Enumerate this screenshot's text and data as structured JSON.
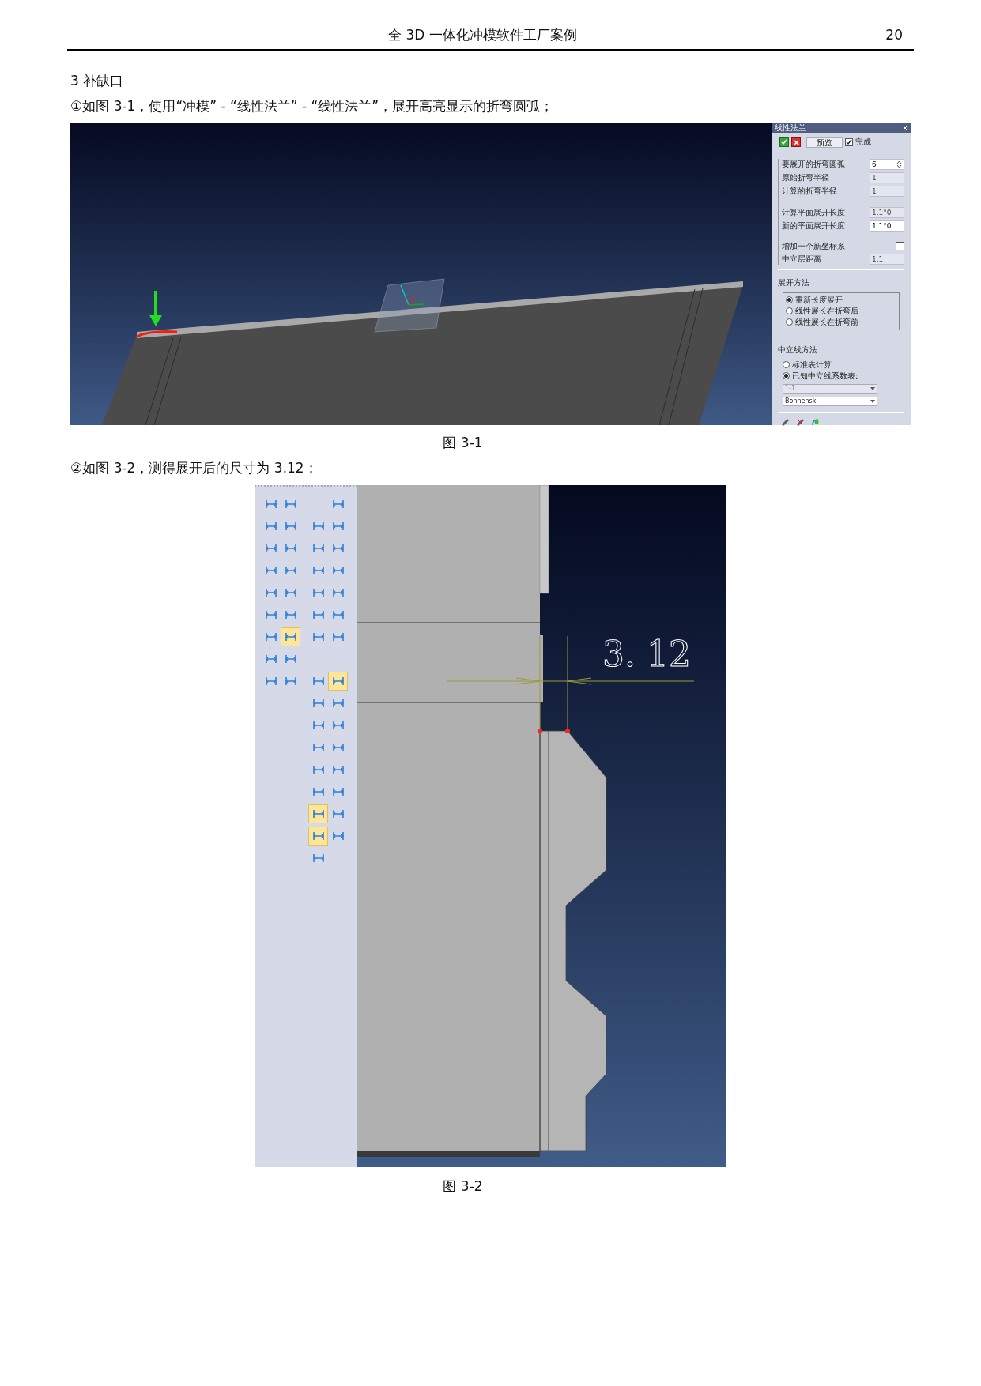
{
  "header": {
    "title": "全 3D 一体化冲模软件工厂案例",
    "page": "20"
  },
  "section_title": "3 补缺口",
  "step_1": "①如图 3-1，使用“冲模” - “线性法兰” - “线性法兰”，展开高亮显示的折弯圆弧；",
  "figure_1": {
    "caption": "图 3-1",
    "dialog": {
      "title": "线性法兰",
      "preview_button": "预览",
      "finish": {
        "label": "完成",
        "checked": true
      },
      "fields": [
        {
          "kind": "spin",
          "label": "要展开的折弯圆弧",
          "value": "6",
          "disabled": false
        },
        {
          "kind": "text",
          "label": "原始折弯半径",
          "value": "1",
          "disabled": true
        },
        {
          "kind": "text",
          "label": "计算的折弯半径",
          "value": "1",
          "disabled": true
        },
        {
          "kind": "text",
          "label": "计算平面展开长度",
          "value": "1.1°0",
          "disabled": true
        },
        {
          "kind": "text",
          "label": "新的平面展开长度",
          "value": "1.1°0",
          "disabled": false
        },
        {
          "kind": "checkbox",
          "label": "增加一个新坐标系",
          "checked": false
        },
        {
          "kind": "text",
          "label": "中立层距离",
          "value": "1.1",
          "disabled": true
        }
      ],
      "unfold_method": {
        "title": "展开方法",
        "options": [
          {
            "label": "重新长度展开",
            "selected": true
          },
          {
            "label": "线性展长在折弯后",
            "selected": false
          },
          {
            "label": "线性展长在折弯前",
            "selected": false
          }
        ]
      },
      "neutral_method": {
        "title": "中立线方法",
        "options": [
          {
            "label": "标准表计算",
            "selected": false
          },
          {
            "label": "已知中立线系数表:",
            "selected": true
          }
        ],
        "selects": [
          {
            "value": "1-1",
            "disabled": true
          },
          {
            "value": "Bonnenski",
            "disabled": false
          }
        ]
      }
    }
  },
  "step_2": "②如图 3-2，测得展开后的尺寸为 3.12；",
  "figure_2": {
    "caption": "图 3-2",
    "dimension": "3. 12",
    "toolbar": [
      [
        {
          "kind": "tool",
          "selected": false
        },
        {
          "kind": "tool",
          "selected": false
        },
        {
          "kind": "blank"
        },
        {
          "kind": "blank"
        },
        {
          "kind": "tool",
          "selected": false
        }
      ],
      [
        {
          "kind": "tool",
          "selected": false
        },
        {
          "kind": "tool",
          "selected": false
        },
        {
          "kind": "blank"
        },
        {
          "kind": "tool",
          "selected": false
        },
        {
          "kind": "tool",
          "selected": false
        }
      ],
      [
        {
          "kind": "tool",
          "selected": false
        },
        {
          "kind": "tool",
          "selected": false
        },
        {
          "kind": "blank"
        },
        {
          "kind": "tool",
          "selected": false
        },
        {
          "kind": "tool",
          "selected": false
        }
      ],
      [
        {
          "kind": "tool",
          "selected": false
        },
        {
          "kind": "tool",
          "selected": false
        },
        {
          "kind": "blank"
        },
        {
          "kind": "tool",
          "selected": false
        },
        {
          "kind": "tool",
          "selected": false
        }
      ],
      [
        {
          "kind": "tool",
          "selected": false
        },
        {
          "kind": "tool",
          "selected": false
        },
        {
          "kind": "blank"
        },
        {
          "kind": "tool",
          "selected": false
        },
        {
          "kind": "tool",
          "selected": false
        }
      ],
      [
        {
          "kind": "tool",
          "selected": false
        },
        {
          "kind": "tool",
          "selected": false
        },
        {
          "kind": "blank"
        },
        {
          "kind": "tool",
          "selected": false
        },
        {
          "kind": "tool",
          "selected": false
        }
      ],
      [
        {
          "kind": "tool",
          "selected": false
        },
        {
          "kind": "tool",
          "selected": true
        },
        {
          "kind": "blank"
        },
        {
          "kind": "tool",
          "selected": false
        },
        {
          "kind": "tool",
          "selected": false
        }
      ],
      [
        {
          "kind": "tool",
          "selected": false
        },
        {
          "kind": "tool",
          "selected": false
        },
        {
          "kind": "blank"
        },
        {
          "kind": "blank"
        },
        {
          "kind": "blank"
        }
      ],
      [
        {
          "kind": "tool",
          "selected": false
        },
        {
          "kind": "tool",
          "selected": false
        },
        {
          "kind": "blank"
        },
        {
          "kind": "tool",
          "selected": false
        },
        {
          "kind": "tool",
          "selected": true
        }
      ],
      [
        {
          "kind": "blank"
        },
        {
          "kind": "blank"
        },
        {
          "kind": "blank"
        },
        {
          "kind": "tool",
          "selected": false
        },
        {
          "kind": "tool",
          "selected": false
        }
      ],
      [
        {
          "kind": "blank"
        },
        {
          "kind": "blank"
        },
        {
          "kind": "blank"
        },
        {
          "kind": "tool",
          "selected": false
        },
        {
          "kind": "tool",
          "selected": false
        }
      ],
      [
        {
          "kind": "blank"
        },
        {
          "kind": "blank"
        },
        {
          "kind": "blank"
        },
        {
          "kind": "tool",
          "selected": false
        },
        {
          "kind": "tool",
          "selected": false
        }
      ],
      [
        {
          "kind": "blank"
        },
        {
          "kind": "blank"
        },
        {
          "kind": "blank"
        },
        {
          "kind": "tool",
          "selected": false
        },
        {
          "kind": "tool",
          "selected": false
        }
      ],
      [
        {
          "kind": "blank"
        },
        {
          "kind": "blank"
        },
        {
          "kind": "blank"
        },
        {
          "kind": "tool",
          "selected": false
        },
        {
          "kind": "tool",
          "selected": false
        }
      ],
      [
        {
          "kind": "blank"
        },
        {
          "kind": "blank"
        },
        {
          "kind": "blank"
        },
        {
          "kind": "tool",
          "selected": true
        },
        {
          "kind": "tool",
          "selected": false
        }
      ],
      [
        {
          "kind": "blank"
        },
        {
          "kind": "blank"
        },
        {
          "kind": "blank"
        },
        {
          "kind": "tool",
          "selected": true
        },
        {
          "kind": "tool",
          "selected": false
        }
      ],
      [
        {
          "kind": "blank"
        },
        {
          "kind": "blank"
        },
        {
          "kind": "blank"
        },
        {
          "kind": "tool",
          "selected": false
        },
        {
          "kind": "blank"
        }
      ]
    ]
  }
}
